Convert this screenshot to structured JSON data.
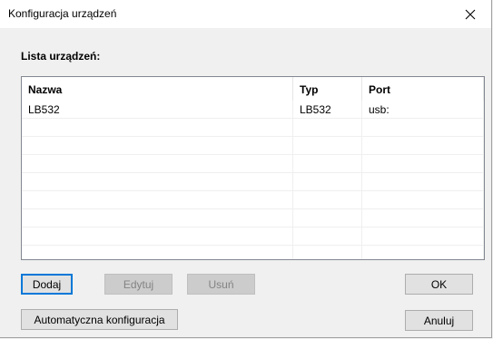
{
  "window": {
    "title": "Konfiguracja urządzeń"
  },
  "devices": {
    "label": "Lista urządzeń:",
    "columns": [
      "Nazwa",
      "Typ",
      "Port"
    ],
    "rows": [
      {
        "name": "LB532",
        "type": "LB532",
        "port": "usb:"
      }
    ]
  },
  "buttons": {
    "add": "Dodaj",
    "edit": "Edytuj",
    "remove": "Usuń",
    "auto_config": "Automatyczna konfiguracja",
    "ok": "OK",
    "cancel": "Anuluj"
  },
  "icons": {
    "close": "close-icon"
  }
}
